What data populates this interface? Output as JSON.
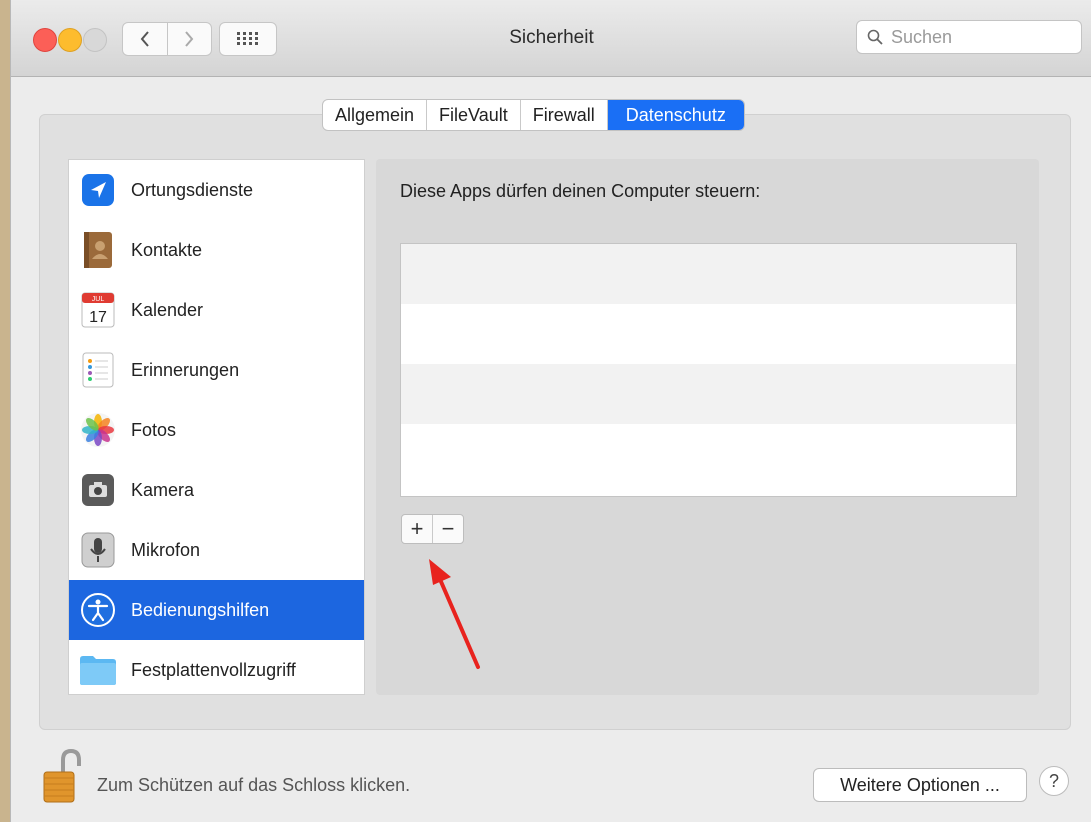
{
  "window": {
    "title": "Sicherheit",
    "search_placeholder": "Suchen"
  },
  "tabs": [
    {
      "label": "Allgemein",
      "active": false
    },
    {
      "label": "FileVault",
      "active": false
    },
    {
      "label": "Firewall",
      "active": false
    },
    {
      "label": "Datenschutz",
      "active": true
    }
  ],
  "sidebar": {
    "items": [
      {
        "label": "Ortungsdienste",
        "icon": "location-icon"
      },
      {
        "label": "Kontakte",
        "icon": "contacts-icon"
      },
      {
        "label": "Kalender",
        "icon": "calendar-icon",
        "calendar_month": "JUL",
        "calendar_day": "17"
      },
      {
        "label": "Erinnerungen",
        "icon": "reminders-icon"
      },
      {
        "label": "Fotos",
        "icon": "photos-icon"
      },
      {
        "label": "Kamera",
        "icon": "camera-icon"
      },
      {
        "label": "Mikrofon",
        "icon": "microphone-icon"
      },
      {
        "label": "Bedienungshilfen",
        "icon": "accessibility-icon",
        "selected": true
      },
      {
        "label": "Festplattenvollzugriff",
        "icon": "folder-icon"
      }
    ]
  },
  "main": {
    "heading": "Diese Apps dürfen deinen Computer steuern:",
    "add_label": "+",
    "remove_label": "−"
  },
  "footer": {
    "lock_text": "Zum Schützen auf das Schloss klicken.",
    "more_options_label": "Weitere Optionen ...",
    "help_label": "?"
  },
  "colors": {
    "accent": "#1a6ff5",
    "annotation_arrow": "#e8231e"
  }
}
